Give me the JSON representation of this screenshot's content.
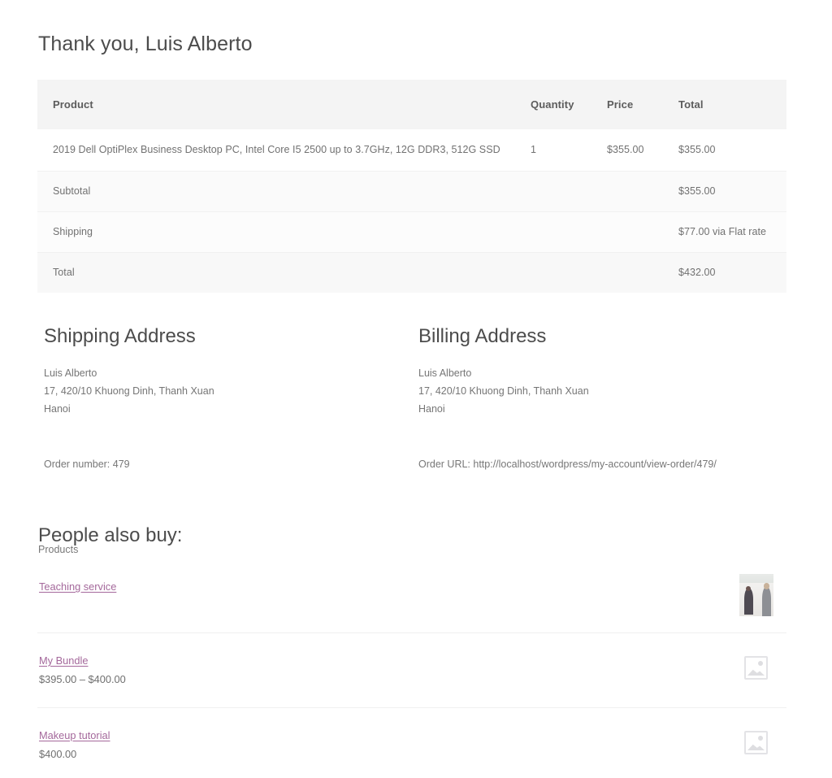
{
  "heading": "Thank you, Luis Alberto",
  "order_table": {
    "columns": [
      "Product",
      "Quantity",
      "Price",
      "Total"
    ],
    "items": [
      {
        "product": "2019 Dell OptiPlex Business Desktop PC, Intel Core I5 2500 up to 3.7GHz, 12G DDR3, 512G SSD",
        "quantity": "1",
        "price": "$355.00",
        "total": "$355.00"
      }
    ],
    "totals": [
      {
        "label": "Subtotal",
        "value": "$355.00"
      },
      {
        "label": "Shipping",
        "value": "$77.00 via Flat rate"
      },
      {
        "label": "Total",
        "value": "$432.00"
      }
    ]
  },
  "shipping_address": {
    "title": "Shipping Address",
    "name": "Luis Alberto",
    "street": "17, 420/10 Khuong Dinh, Thanh Xuan",
    "city": "Hanoi"
  },
  "billing_address": {
    "title": "Billing Address",
    "name": "Luis Alberto",
    "street": "17, 420/10 Khuong Dinh, Thanh Xuan",
    "city": "Hanoi"
  },
  "order_meta": {
    "order_number": "Order number: 479",
    "order_url": "Order URL: http://localhost/wordpress/my-account/view-order/479/"
  },
  "people_also_buy": {
    "title": "People also buy:",
    "subtitle": "Products",
    "items": [
      {
        "name": "Teaching service",
        "price": "",
        "thumb": "photo-thumbnail"
      },
      {
        "name": "My Bundle",
        "price": "$395.00 – $400.00",
        "thumb": "image-placeholder-icon"
      },
      {
        "name": "Makeup tutorial",
        "price": "$400.00",
        "thumb": "image-placeholder-icon"
      }
    ]
  },
  "colors": {
    "link": "#a4689b",
    "text": "#6d6d6d",
    "heading": "#4c4c4c",
    "table_header_bg": "#f4f4f4"
  }
}
